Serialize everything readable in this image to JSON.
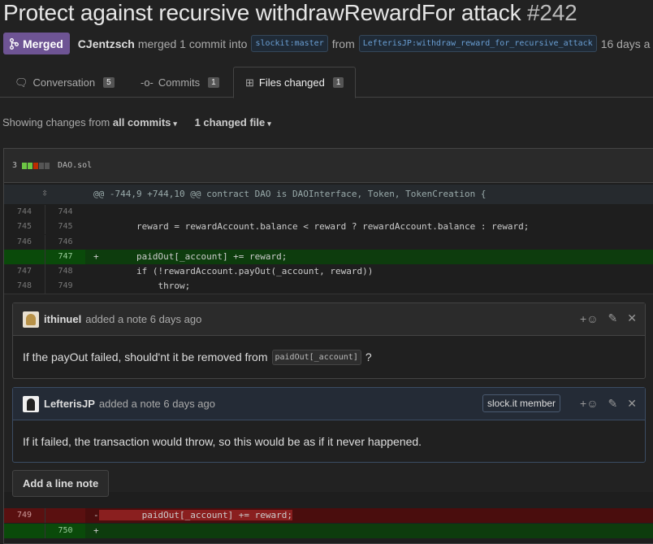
{
  "pr": {
    "title": "Protect against recursive withdrawRewardFor attack",
    "number": "#242",
    "state": "Merged",
    "author": "CJentzsch",
    "action": "merged 1 commit into",
    "base_branch": "slockit:master",
    "from_word": "from",
    "head_branch": "LefterisJP:withdraw_reward_for_recursive_attack",
    "time": "16 days a"
  },
  "tabs": [
    {
      "label": "Conversation",
      "count": "5",
      "icon": "comment-icon"
    },
    {
      "label": "Commits",
      "count": "1",
      "icon": "commit-icon"
    },
    {
      "label": "Files changed",
      "count": "1",
      "icon": "diff-icon"
    }
  ],
  "toolbar": {
    "showing_prefix": "Showing changes from",
    "commits_filter": "all commits",
    "changed_files": "1 changed file"
  },
  "file": {
    "change_count": "3",
    "name": "DAO.sol",
    "colors": {
      "add": "#6cc644",
      "del": "#bd2c00",
      "neutral": "#555555"
    }
  },
  "hunk": "@@ -744,9 +744,10 @@ contract DAO is DAOInterface, Token, TokenCreation {",
  "diff_lines": [
    {
      "old": "744",
      "new": "744",
      "code": ""
    },
    {
      "old": "745",
      "new": "745",
      "code": "        reward = rewardAccount.balance < reward ? rewardAccount.balance : reward;"
    },
    {
      "old": "746",
      "new": "746",
      "code": ""
    },
    {
      "old": "",
      "new": "747",
      "code": "+       paidOut[_account] += reward;"
    },
    {
      "old": "747",
      "new": "748",
      "code": "        if (!rewardAccount.payOut(_account, reward))"
    },
    {
      "old": "748",
      "new": "749",
      "code": "            throw;"
    }
  ],
  "comments": [
    {
      "author": "ithinuel",
      "action": "added a note 6 days ago",
      "body_before": "If the payOut failed, should'nt it be removed from",
      "code": "paidOut[_account]",
      "body_after": "?"
    },
    {
      "author": "LefterisJP",
      "action": "added a note 6 days ago",
      "badge": "slock.it member",
      "body": "If it failed, the transaction would throw, so this would be as if it never happened."
    }
  ],
  "add_note_label": "Add a line note",
  "diff_after": [
    {
      "old": "749",
      "new": "",
      "prefix": "-",
      "code": "        paidOut[_account] += reward;"
    },
    {
      "old": "",
      "new": "750",
      "prefix": "+",
      "code": ""
    }
  ],
  "icons": {
    "add_reaction": "+☺",
    "edit": "✎",
    "close": "✕"
  }
}
